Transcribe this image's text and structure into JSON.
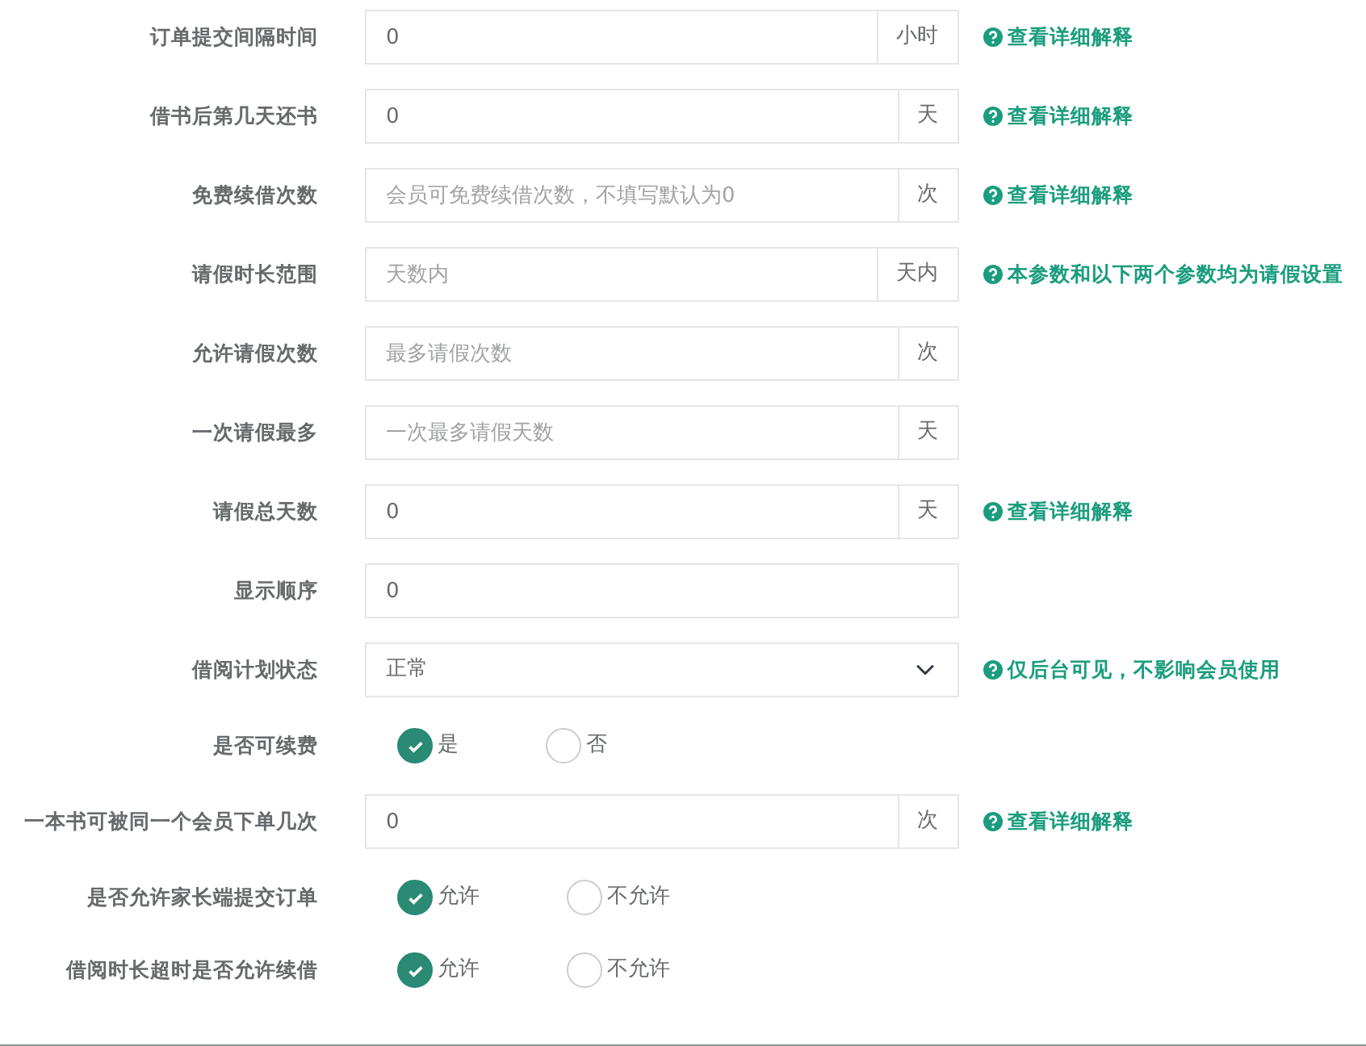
{
  "fields": [
    {
      "kind": "input",
      "label": "订单提交间隔时间",
      "value": "0",
      "addon": "小时",
      "help": "查看详细解释"
    },
    {
      "kind": "input",
      "label": "借书后第几天还书",
      "value": "0",
      "addon": "天",
      "help": "查看详细解释"
    },
    {
      "kind": "input",
      "label": "免费续借次数",
      "placeholder": "会员可免费续借次数，不填写默认为0",
      "addon": "次",
      "help": "查看详细解释"
    },
    {
      "kind": "input",
      "label": "请假时长范围",
      "placeholder": "天数内",
      "addon": "天内",
      "help": "本参数和以下两个参数均为请假设置"
    },
    {
      "kind": "input",
      "label": "允许请假次数",
      "placeholder": "最多请假次数",
      "addon": "次"
    },
    {
      "kind": "input",
      "label": "一次请假最多",
      "placeholder": "一次最多请假天数",
      "addon": "天"
    },
    {
      "kind": "input",
      "label": "请假总天数",
      "value": "0",
      "addon": "天",
      "help": "查看详细解释"
    },
    {
      "kind": "input",
      "label": "显示顺序",
      "value": "0"
    },
    {
      "kind": "select",
      "label": "借阅计划状态",
      "value": "正常",
      "help": "仅后台可见，不影响会员使用"
    },
    {
      "kind": "radio",
      "label": "是否可续费",
      "options": [
        {
          "label": "是",
          "selected": true
        },
        {
          "label": "否",
          "selected": false
        }
      ]
    },
    {
      "kind": "input",
      "label": "一本书可被同一个会员下单几次",
      "value": "0",
      "addon": "次",
      "help": "查看详细解释"
    },
    {
      "kind": "radio",
      "label": "是否允许家长端提交订单",
      "options": [
        {
          "label": "允许",
          "selected": true
        },
        {
          "label": "不允许",
          "selected": false
        }
      ]
    },
    {
      "kind": "radio",
      "label": "借阅时长超时是否允许续借",
      "options": [
        {
          "label": "允许",
          "selected": true
        },
        {
          "label": "不允许",
          "selected": false
        }
      ]
    }
  ]
}
